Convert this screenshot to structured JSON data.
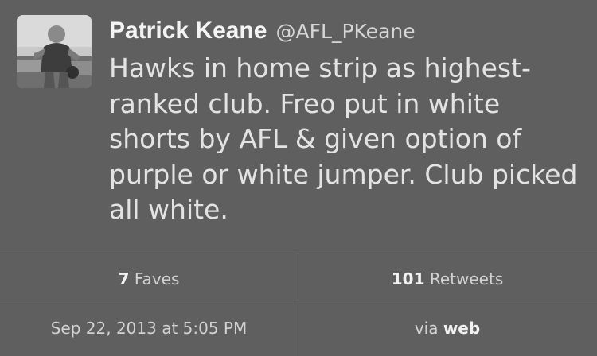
{
  "tweet": {
    "display_name": "Patrick Keane",
    "handle": "@AFL_PKeane",
    "text": "Hawks in home strip as highest-ranked club. Freo put in white shorts by AFL & given option of purple or white jumper. Club picked all white.",
    "avatar_icon": "profile-photo"
  },
  "stats": {
    "faves_count": "7",
    "faves_label": "Faves",
    "retweets_count": "101",
    "retweets_label": "Retweets"
  },
  "meta": {
    "timestamp": "Sep 22, 2013 at 5:05 PM",
    "via_label": "via",
    "via_source": "web"
  },
  "colors": {
    "background": "#5f5f5f",
    "divider": "#777777",
    "text": "#e3e3e3"
  }
}
